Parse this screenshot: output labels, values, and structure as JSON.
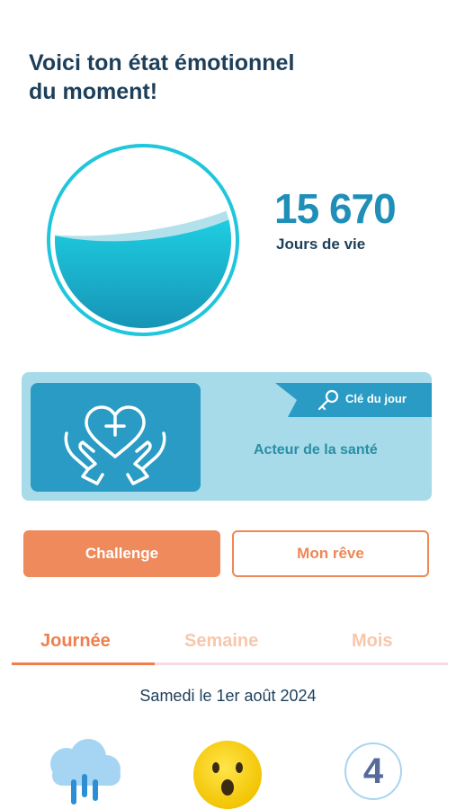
{
  "header": {
    "title_line1": "Voici ton état émotionnel",
    "title_line2": "du moment!"
  },
  "mood": {
    "fill_level": 0.45,
    "ring_color": "#1fc6dc"
  },
  "stats": {
    "value": "15 670",
    "label": "Jours de vie"
  },
  "key_of_day": {
    "ribbon_label": "Clé du jour",
    "value": "Acteur  de la santé",
    "icon": "heart-plus-hands-icon"
  },
  "actions": {
    "challenge_label": "Challenge",
    "dream_label": "Mon rêve"
  },
  "tabs": [
    {
      "label": "Journée",
      "active": true
    },
    {
      "label": "Semaine",
      "active": false
    },
    {
      "label": "Mois",
      "active": false
    }
  ],
  "date": "Samedi le 1er août 2024",
  "summary": {
    "weather_icon": "rain-cloud-icon",
    "emoji_icon": "surprised-face-icon",
    "level": "4"
  },
  "colors": {
    "accent_orange": "#ef8756",
    "accent_blue": "#2a9bc4",
    "dark_text": "#1d3f5a"
  }
}
